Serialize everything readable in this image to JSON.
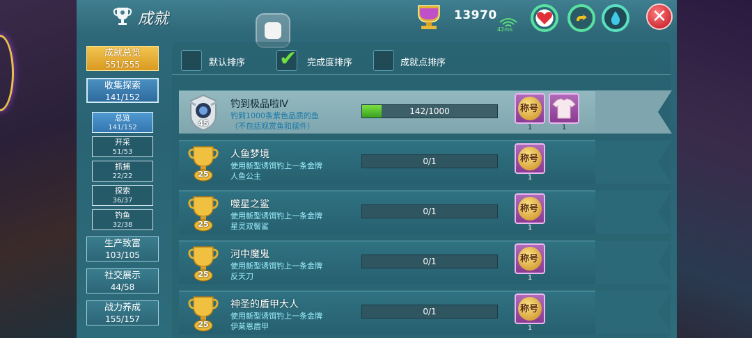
{
  "header": {
    "title": "成就",
    "score": "13970",
    "ping": "42ms"
  },
  "colors": {
    "panel": "#2d6c7a",
    "gold": "#e2b03a",
    "progress_green": "#5ad030",
    "reward_purple": "#9a4aa2",
    "close_red": "#d0303a"
  },
  "sidebar": {
    "overview": {
      "label": "成就总览",
      "value": "551/555"
    },
    "collect": {
      "label": "收集探索",
      "value": "141/152"
    },
    "sub_items": [
      {
        "label": "总览",
        "value": "141/152"
      },
      {
        "label": "开采",
        "value": "51/53"
      },
      {
        "label": "抓捕",
        "value": "22/22"
      },
      {
        "label": "探索",
        "value": "36/37"
      },
      {
        "label": "钓鱼",
        "value": "32/38"
      }
    ],
    "production": {
      "label": "生产致富",
      "value": "103/105"
    },
    "social": {
      "label": "社交展示",
      "value": "44/58"
    },
    "combat": {
      "label": "战力养成",
      "value": "155/157"
    }
  },
  "sort": {
    "default": "默认排序",
    "completion": "完成度排序",
    "points": "成就点排序",
    "selected": "completion"
  },
  "achievements": [
    {
      "name": "钓到极品啦Ⅳ",
      "desc1": "钓到1000条紫色品质的鱼",
      "desc2": "（不包括观赏鱼和摆件）",
      "progress": "142/1000",
      "fraction": 0.142,
      "badge": "45",
      "rewards": [
        {
          "label": "称号",
          "count": "1"
        },
        {
          "label": "",
          "count": "1"
        }
      ]
    },
    {
      "name": "人鱼梦境",
      "desc1": "使用新型诱饵钓上一条金牌",
      "desc2": "人鱼公主",
      "progress": "0/1",
      "fraction": 0,
      "badge": "25",
      "rewards": [
        {
          "label": "称号",
          "count": "1"
        }
      ]
    },
    {
      "name": "噬星之鲨",
      "desc1": "使用新型诱饵钓上一条金牌",
      "desc2": "星灵双髻鲨",
      "progress": "0/1",
      "fraction": 0,
      "badge": "25",
      "rewards": [
        {
          "label": "称号",
          "count": "1"
        }
      ]
    },
    {
      "name": "河中魔鬼",
      "desc1": "使用新型诱饵钓上一条金牌",
      "desc2": "反天刀",
      "progress": "0/1",
      "fraction": 0,
      "badge": "25",
      "rewards": [
        {
          "label": "称号",
          "count": "1"
        }
      ]
    },
    {
      "name": "神圣的盾甲大人",
      "desc1": "使用新型诱饵钓上一条金牌",
      "desc2": "伊莱恩盾甲",
      "progress": "0/1",
      "fraction": 0,
      "badge": "25",
      "rewards": [
        {
          "label": "称号",
          "count": "1"
        }
      ]
    }
  ],
  "icons": {
    "title": "trophy-icon",
    "score": "gold-cup-icon",
    "signal": "wifi-signal-icon",
    "stats": [
      "heart-icon",
      "stamina-icon",
      "water-drop-icon"
    ],
    "close": "close-icon"
  }
}
